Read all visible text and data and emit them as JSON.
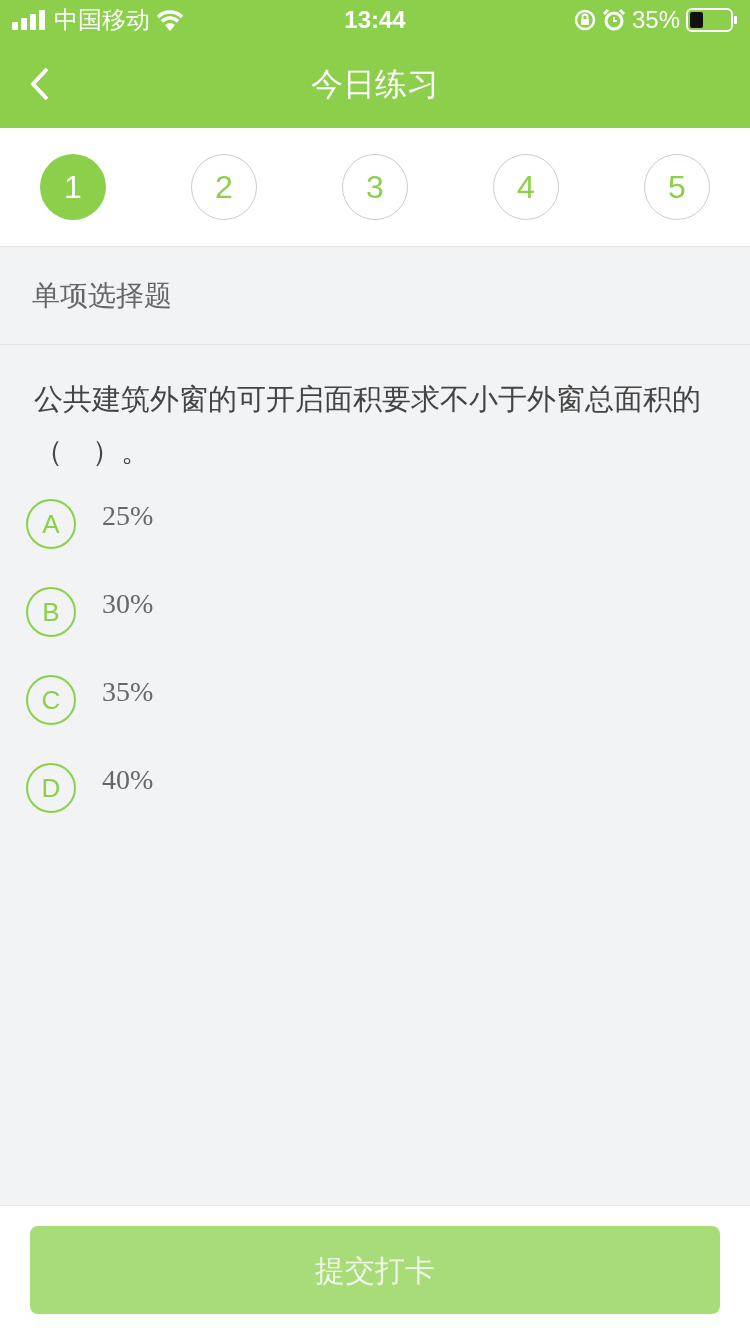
{
  "status_bar": {
    "carrier": "中国移动",
    "time": "13:44",
    "battery": "35%"
  },
  "nav": {
    "title": "今日练习"
  },
  "steps": [
    {
      "label": "1",
      "selected": true
    },
    {
      "label": "2",
      "selected": false
    },
    {
      "label": "3",
      "selected": false
    },
    {
      "label": "4",
      "selected": false
    },
    {
      "label": "5",
      "selected": false
    }
  ],
  "section": "单项选择题",
  "question": "公共建筑外窗的可开启面积要求不小于外窗总面积的（　）。",
  "options": [
    {
      "letter": "A",
      "text": "25%",
      "selected": false
    },
    {
      "letter": "B",
      "text": "30%",
      "selected": false
    },
    {
      "letter": "C",
      "text": "35%",
      "selected": false
    },
    {
      "letter": "D",
      "text": "40%",
      "selected": false
    }
  ],
  "submit": {
    "label": "提交打卡",
    "disabled": true
  }
}
